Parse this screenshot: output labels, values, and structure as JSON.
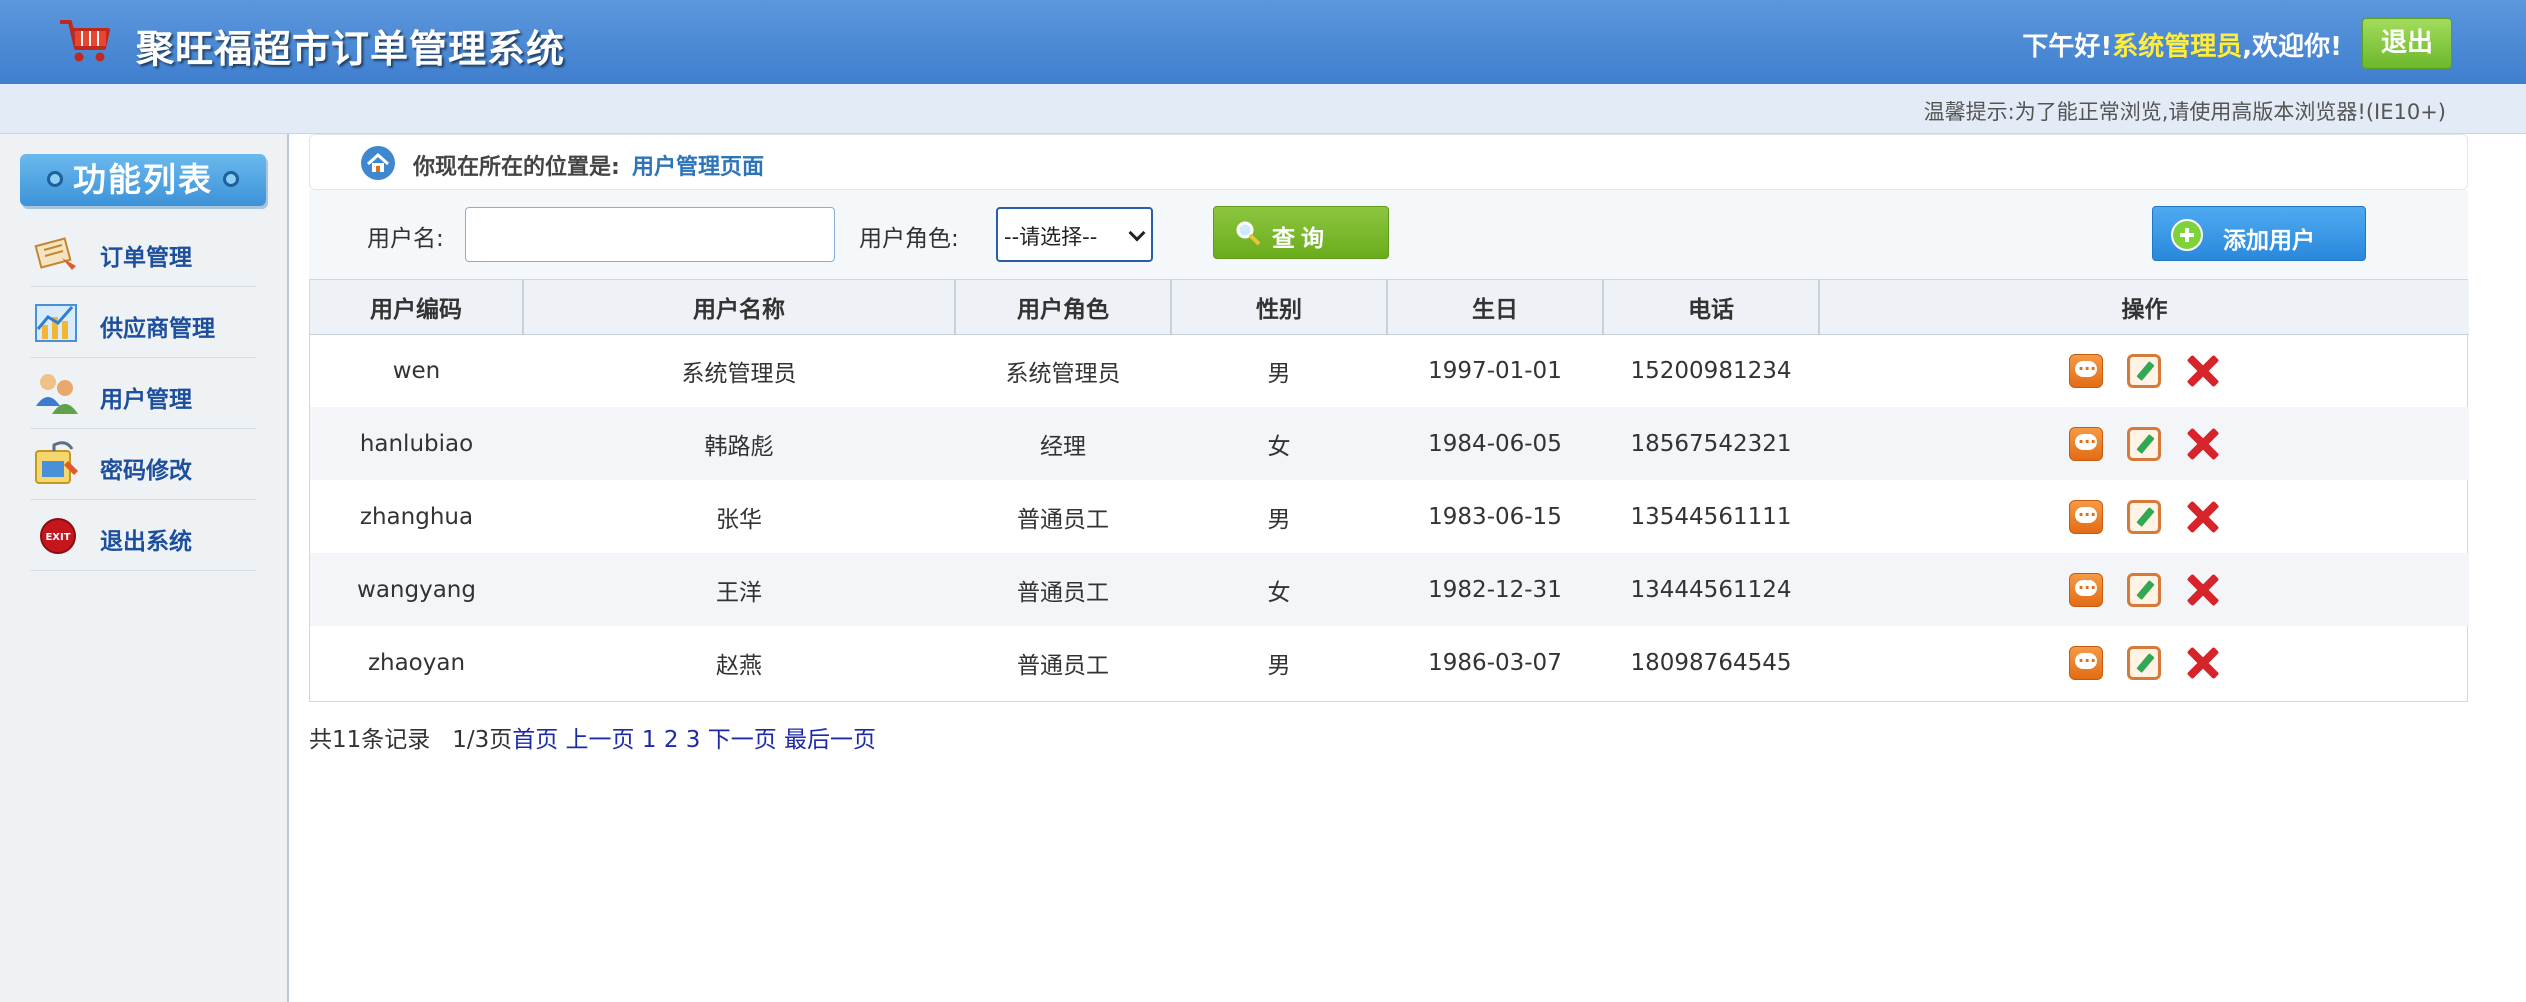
{
  "header": {
    "title": "聚旺福超市订单管理系统",
    "greeting_prefix": "下午好!",
    "username": "系统管理员",
    "greeting_suffix": ",欢迎你!",
    "logout_label": "退出"
  },
  "tip": {
    "text": "温馨提示:为了能正常浏览,请使用高版本浏览器!(IE10+)"
  },
  "sidebar": {
    "title": "功能列表",
    "items": [
      {
        "label": "订单管理",
        "icon": "order-icon"
      },
      {
        "label": "供应商管理",
        "icon": "supplier-icon"
      },
      {
        "label": "用户管理",
        "icon": "users-icon"
      },
      {
        "label": "密码修改",
        "icon": "password-icon"
      },
      {
        "label": "退出系统",
        "icon": "exit-icon"
      }
    ]
  },
  "location": {
    "label": "你现在所在的位置是:",
    "page": "用户管理页面"
  },
  "search": {
    "username_label": "用户名:",
    "username_value": "",
    "role_label": "用户角色:",
    "role_selected": "--请选择--",
    "query_label": "查询",
    "add_label": "添加用户"
  },
  "table": {
    "columns": [
      "用户编码",
      "用户名称",
      "用户角色",
      "性别",
      "生日",
      "电话",
      "操作"
    ],
    "rows": [
      [
        "wen",
        "系统管理员",
        "系统管理员",
        "男",
        "1997-01-01",
        "15200981234"
      ],
      [
        "hanlubiao",
        "韩路彪",
        "经理",
        "女",
        "1984-06-05",
        "18567542321"
      ],
      [
        "zhanghua",
        "张华",
        "普通员工",
        "男",
        "1983-06-15",
        "13544561111"
      ],
      [
        "wangyang",
        "王洋",
        "普通员工",
        "女",
        "1982-12-31",
        "13444561124"
      ],
      [
        "zhaoyan",
        "赵燕",
        "普通员工",
        "男",
        "1986-03-07",
        "18098764545"
      ]
    ]
  },
  "pager": {
    "total": "共11条记录",
    "pages": "1/3页",
    "first": "首页",
    "prev": "上一页",
    "p1": "1",
    "p2": "2",
    "p3": "3",
    "next": "下一页",
    "last": "最后一页"
  }
}
